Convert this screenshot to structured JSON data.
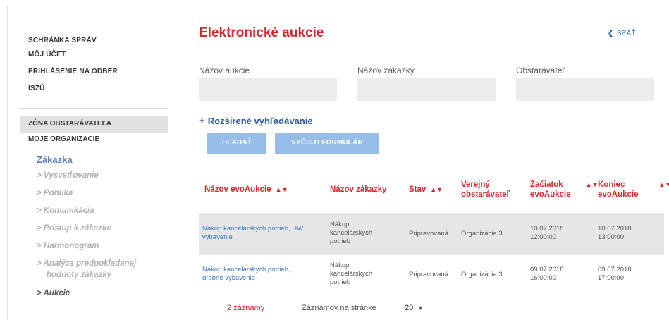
{
  "sidebar": {
    "top_items": [
      "SCHRÁNKA SPRÁV",
      "MÔJ ÚČET",
      "PRIHLÁSENIE NA ODBER",
      "ISZÚ"
    ],
    "zone": "ZÓNA OBSTARÁVATEĽA",
    "org": "MOJE ORGANIZÁCIE",
    "zakazka": "Zákazka",
    "sub_items": [
      "> Vysvetľovanie",
      "> Ponuka",
      "> Komunikácia",
      "> Prístup k zákazke",
      "> Harmonogram",
      "> Analýza predpokladanej",
      "hodnoty zákazky",
      "> Aukcie"
    ]
  },
  "main": {
    "title": "Elektronické aukcie",
    "back": "SPÄŤ",
    "filters": {
      "auction_label": "Názov aukcie",
      "order_label": "Názov zákazky",
      "buyer_label": "Obstarávateľ"
    },
    "advanced": "Rozšírené vyhľadávanie",
    "search_btn": "HĽADAŤ",
    "clear_btn": "VYČISTI FORMULÁR"
  },
  "table": {
    "headers": {
      "name": "Názov evoAukcie",
      "order": "Názov zákazky",
      "state": "Stav",
      "buyer_1": "Verejný",
      "buyer_2": "obstarávateľ",
      "start_1": "Začiatok",
      "start_2": "evoAukcie",
      "end_1": "Koniec",
      "end_2": "evoAukcie"
    },
    "rows": [
      {
        "name_1": "Nákup kancelárskych potrieb, HW",
        "name_2": "vybavenie",
        "order_1": "Nákup",
        "order_2": "kancelárskych",
        "order_3": "potrieb",
        "state": "Pripravovaná",
        "buyer": "Organizácia 3",
        "start_1": "10.07.2018",
        "start_2": "12:00:00",
        "end_1": "10.07.2018",
        "end_2": "13:00:00"
      },
      {
        "name_1": "Nákup kancelárskych potrieb,",
        "name_2": "drobné vybavenie",
        "order_1": "Nákup",
        "order_2": "kancelárskych",
        "order_3": "potrieb",
        "state": "Pripravovaná",
        "buyer": "Organizácia 3",
        "start_1": "09.07.2018",
        "start_2": "16:00:00",
        "end_1": "09.07.2018",
        "end_2": "17:00:00"
      }
    ]
  },
  "pager": {
    "count": "2 záznamy",
    "per_page_label": "Záznamov na stránke",
    "per_page_value": "20"
  }
}
